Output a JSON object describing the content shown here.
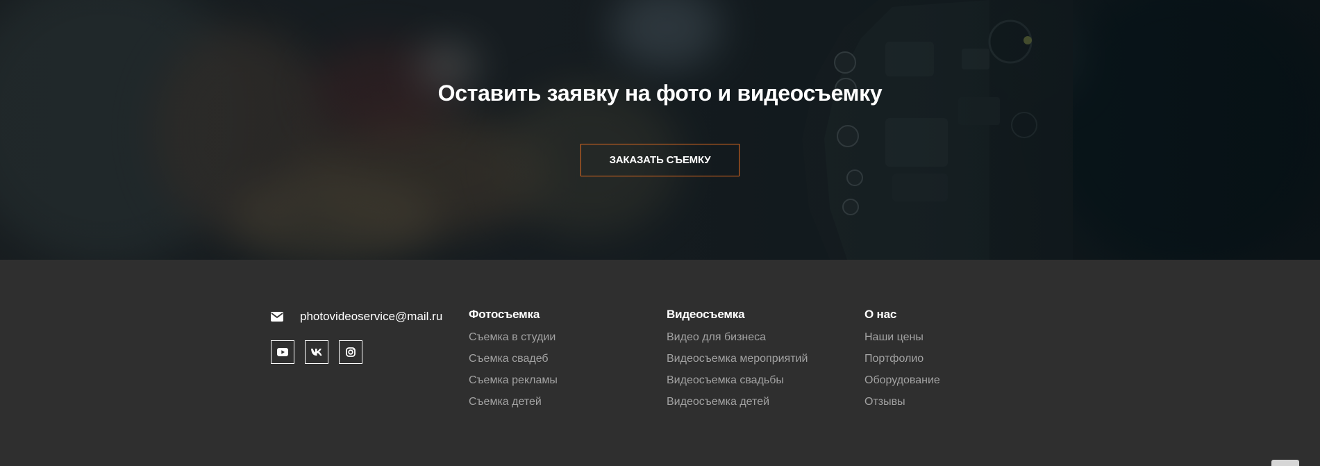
{
  "hero": {
    "title": "Оставить заявку на фото и видеосъемку",
    "button_label": "ЗАКАЗАТЬ СЪЕМКУ",
    "accent_color": "#e26b1f"
  },
  "contact": {
    "email": "photovideoservice@mail.ru",
    "icons": [
      "envelope-icon",
      "youtube-icon",
      "vk-icon",
      "instagram-icon"
    ]
  },
  "footer": {
    "columns": [
      {
        "title": "Фотосъемка",
        "items": [
          "Съемка в студии",
          "Съемка свадеб",
          "Съемка рекламы",
          "Съемка детей"
        ]
      },
      {
        "title": "Видеосъемка",
        "items": [
          "Видео для бизнеса",
          "Видеосъемка мероприятий",
          "Видеосъемка свадьбы",
          "Видеосъемка детей"
        ]
      },
      {
        "title": "О нас",
        "items": [
          "Наши цены",
          "Портфолио",
          "Оборудование",
          "Отзывы"
        ]
      }
    ],
    "background_color": "#2f2f2f",
    "link_color": "#a2a2a2"
  }
}
